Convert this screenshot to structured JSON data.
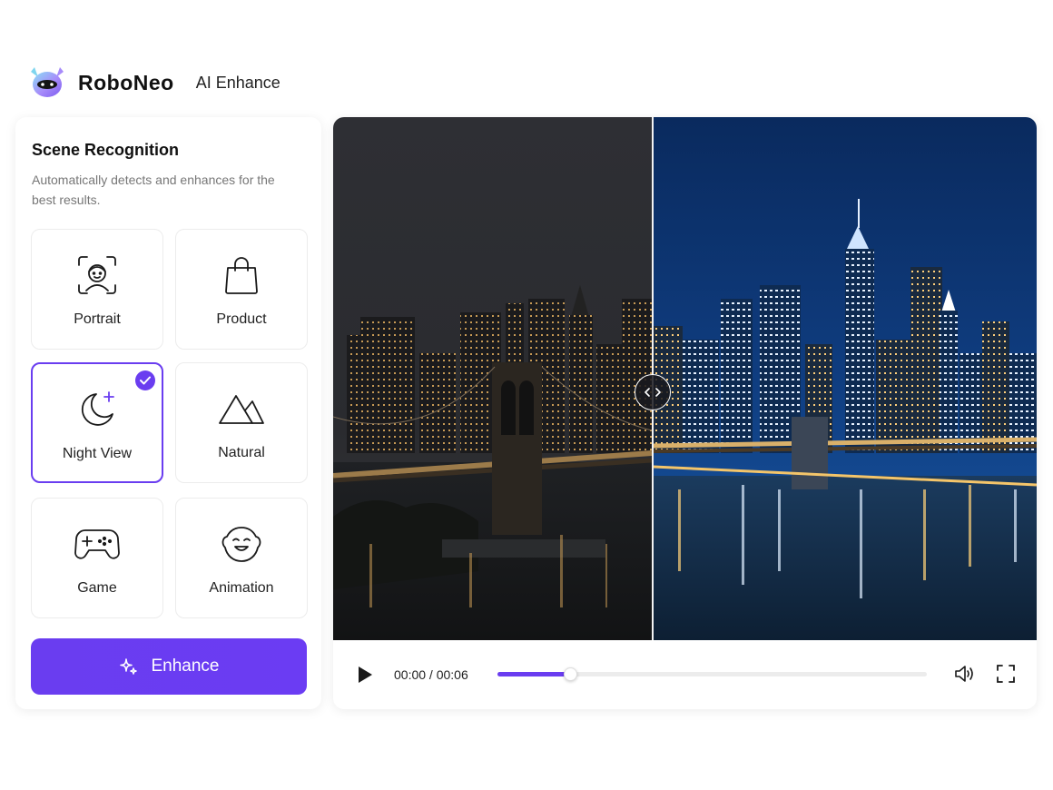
{
  "header": {
    "brand": "RoboNeo",
    "subtitle": "AI Enhance"
  },
  "panel": {
    "title": "Scene Recognition",
    "description": "Automatically detects and enhances for the best results.",
    "scenes": [
      {
        "label": "Portrait",
        "icon": "portrait-icon",
        "selected": false
      },
      {
        "label": "Product",
        "icon": "shopping-bag-icon",
        "selected": false
      },
      {
        "label": "Night View",
        "icon": "moon-star-icon",
        "selected": true
      },
      {
        "label": "Natural",
        "icon": "mountain-icon",
        "selected": false
      },
      {
        "label": "Game",
        "icon": "gamepad-icon",
        "selected": false
      },
      {
        "label": "Animation",
        "icon": "cartoon-face-icon",
        "selected": false
      }
    ],
    "enhance_label": "Enhance"
  },
  "player": {
    "time": "00:00 / 00:06",
    "progress": 0.17,
    "compare_split": 0.455
  },
  "colors": {
    "accent": "#6a3df0",
    "before_sky": "#2b2c30",
    "after_sky": "#0d3a7a"
  }
}
